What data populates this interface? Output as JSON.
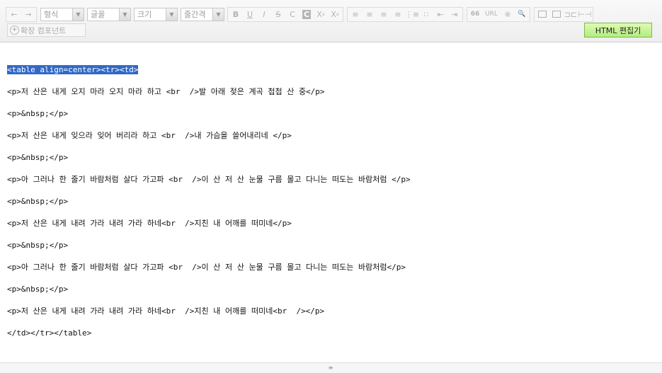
{
  "toolbar": {
    "undo_icon": "←",
    "redo_icon": "→",
    "format_select": "형식",
    "font_select": "글꼴",
    "size_select": "크기",
    "line_height_select": "줄간격",
    "bold": "B",
    "underline": "U",
    "italic": "I",
    "strike": "S",
    "text_color": "C",
    "bg_color": "C",
    "superscript": "X",
    "subscript": "X",
    "quote": "66",
    "url": "URL",
    "special_char": "※",
    "find": "🔍",
    "extension_label": "확장 컴포넌트",
    "html_button": "HTML 편집기"
  },
  "editor": {
    "selected_line": "<table align=center><tr><td>",
    "lines": [
      "<p>저 산은 내게 오지 마라 오지 마라 하고 <br  />발 아래 젖은 계곡 첩첩 산 중</p>",
      "<p>&nbsp;</p>",
      "<p>저 산은 내게 잊으라 잊어 버리라 하고 <br  />내 가슴을 쓸어내리네 </p>",
      "<p>&nbsp;</p>",
      "<p>아 그러나 한 줄기 바람처럼 살다 가고파 <br  />이 산 저 산 눈물 구름 몰고 다니는 떠도는 바람처럼 </p>",
      "<p>&nbsp;</p>",
      "<p>저 산은 내게 내려 가라 내려 가라 하네<br  />지친 내 어깨를 떠미네</p>",
      "<p>&nbsp;</p>",
      "<p>아 그러나 한 줄기 바람처럼 살다 가고파 <br  />이 산 저 산 눈물 구름 몰고 다니는 떠도는 바람처럼</p>",
      "<p>&nbsp;</p>",
      "<p>저 산은 내게 내려 가라 내려 가라 하네<br  />지친 내 어깨를 떠미네<br  /></p>",
      "</td></tr></table>"
    ]
  },
  "resize_grip": "≡"
}
